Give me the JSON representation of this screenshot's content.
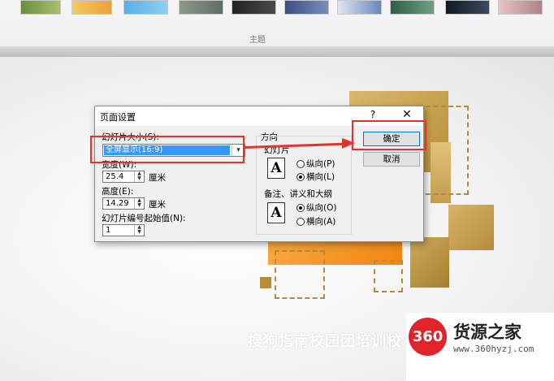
{
  "ribbon": {
    "theme_colors": [
      "#5b7a3a",
      "#e8b84a",
      "#4aa0d8",
      "#7a8a7a",
      "#2b2b2b",
      "#5c6fa0",
      "#6a86b8",
      "#2f5e45",
      "#1e2b3a",
      "#c49aa0"
    ],
    "group_label": "主题"
  },
  "dialog": {
    "title": "页面设置",
    "help_glyph": "?",
    "close_glyph": "✕",
    "slide_size_label": "幻灯片大小(S):",
    "slide_size_value": "全屏显示(16:9)",
    "width_label": "宽度(W):",
    "width_value": "25.4",
    "width_unit": "厘米",
    "height_label": "高度(E):",
    "height_value": "14.29",
    "height_unit": "厘米",
    "start_number_label": "幻灯片编号起始值(N):",
    "start_number_value": "1",
    "orientation_label": "方向",
    "slides_group_label": "幻灯片",
    "slides_portrait": "纵向(P)",
    "slides_landscape": "横向(L)",
    "notes_group_label": "备注、讲义和大纲",
    "notes_portrait": "纵向(O)",
    "notes_landscape": "横向(A)",
    "page_icon_letter": "A",
    "ok_label": "确定",
    "cancel_label": "取消"
  },
  "slide": {
    "caption": "搜狗指南校园团培训校"
  },
  "watermark": {
    "badge": "360",
    "name": "货源之家",
    "url": "www.360hyzj.com"
  },
  "colors": {
    "highlight": "#e8312c",
    "gold": "#c9a24e",
    "orange": "#f4901e",
    "selection": "#3399ff"
  }
}
